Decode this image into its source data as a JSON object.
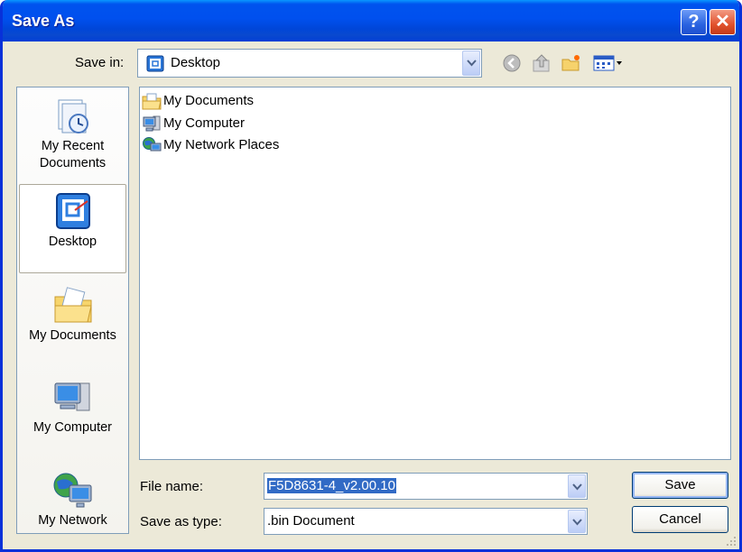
{
  "window": {
    "title": "Save As"
  },
  "titlebar": {
    "help_glyph": "?",
    "close_glyph": "✕"
  },
  "save_in": {
    "label": "Save in:",
    "value": "Desktop",
    "icon": "desktop-icon"
  },
  "toolbar": {
    "icons": [
      "back-icon",
      "up-folder-icon",
      "new-folder-icon",
      "view-menu-icon"
    ]
  },
  "places": [
    {
      "name": "My Recent Documents",
      "line1": "My Recent",
      "line2": "Documents",
      "icon": "recent-documents-icon",
      "selected": false
    },
    {
      "name": "Desktop",
      "line1": "Desktop",
      "line2": "",
      "icon": "desktop-icon",
      "selected": true
    },
    {
      "name": "My Documents",
      "line1": "My Documents",
      "line2": "",
      "icon": "my-documents-icon",
      "selected": false
    },
    {
      "name": "My Computer",
      "line1": "My Computer",
      "line2": "",
      "icon": "my-computer-icon",
      "selected": false
    },
    {
      "name": "My Network",
      "line1": "My Network",
      "line2": "",
      "icon": "my-network-icon",
      "selected": false
    }
  ],
  "files": [
    {
      "name": "My Documents",
      "icon": "folder-documents-icon"
    },
    {
      "name": "My Computer",
      "icon": "computer-icon"
    },
    {
      "name": "My Network Places",
      "icon": "network-icon"
    }
  ],
  "file_name": {
    "label": "File name:",
    "value": "F5D8631-4_v2.00.10"
  },
  "save_as_type": {
    "label": "Save as type:",
    "value": ".bin Document"
  },
  "buttons": {
    "save": "Save",
    "cancel": "Cancel"
  },
  "colors": {
    "titlebar": "#0054e3",
    "selection": "#316ac5",
    "dialog_bg": "#ece9d8"
  }
}
